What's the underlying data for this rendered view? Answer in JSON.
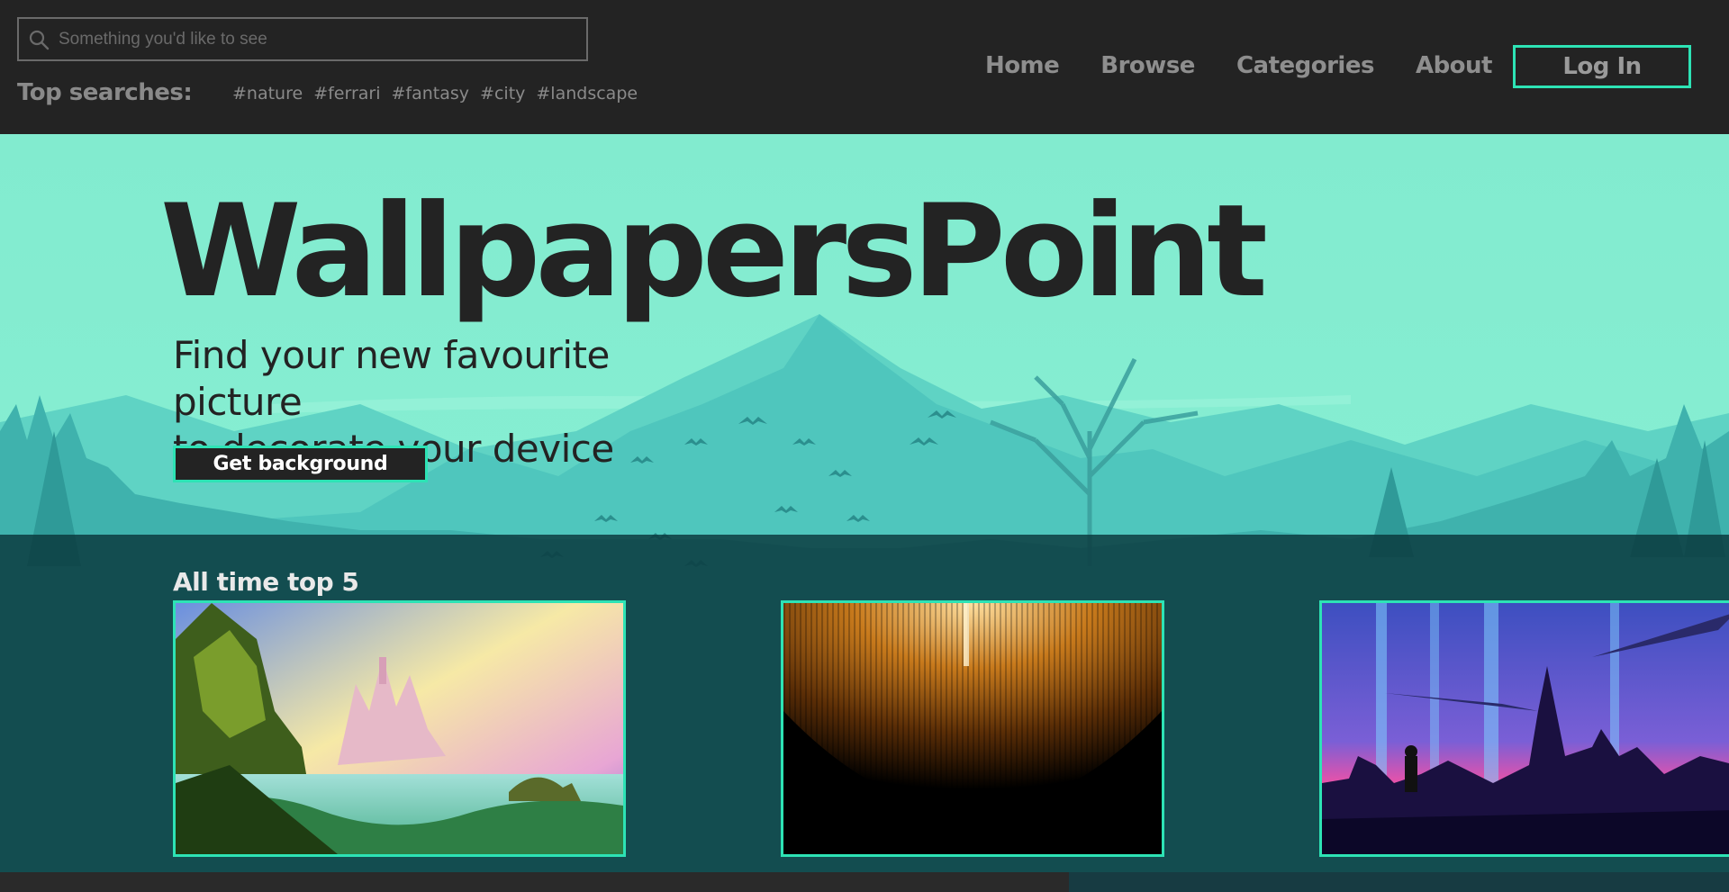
{
  "header": {
    "search": {
      "placeholder": "Something you'd like to see",
      "value": "",
      "icon": "search-icon"
    },
    "top_searches_label": "Top searches:",
    "top_searches": [
      "#nature",
      "#ferrari",
      "#fantasy",
      "#city",
      "#landscape"
    ],
    "nav": [
      "Home",
      "Browse",
      "Categories",
      "About"
    ],
    "login_label": "Log In"
  },
  "hero": {
    "brand": "WallpapersPoint",
    "tagline_line1": "Find your new favourite picture",
    "tagline_line2": "to decorate your device",
    "cta_label": "Get background"
  },
  "top5": {
    "title": "All time top 5",
    "items": [
      "fantasy-castle-landscape",
      "golden-light-rain",
      "neon-city-night"
    ]
  },
  "colors": {
    "background": "#232323",
    "accent": "#2de3b5",
    "hero_sky": "#84ecd0",
    "section_overlay": "#0a373c"
  }
}
